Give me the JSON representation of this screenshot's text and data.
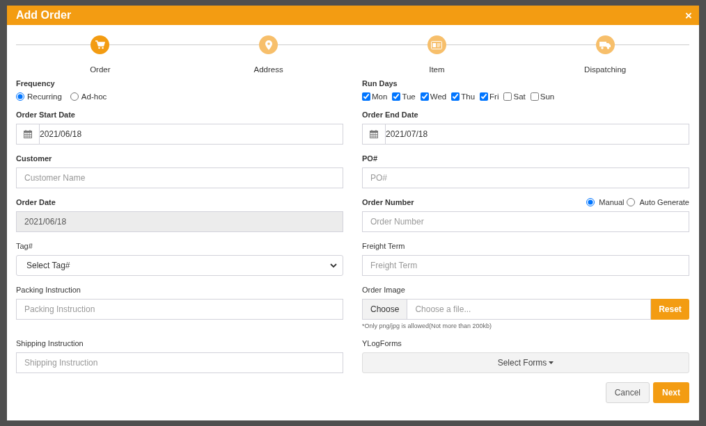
{
  "header": {
    "title": "Add Order",
    "close": "×"
  },
  "steps": [
    {
      "label": "Order",
      "selected": true
    },
    {
      "label": "Address",
      "selected": false
    },
    {
      "label": "Item",
      "selected": false
    },
    {
      "label": "Dispatching",
      "selected": false
    }
  ],
  "rows": [
    {
      "cells": [
        {
          "kind": "radio-group",
          "label": "Frequency",
          "required": true,
          "options": [
            {
              "label": "Recurring",
              "selected": true
            },
            {
              "label": "Ad-hoc",
              "selected": false
            }
          ]
        },
        {
          "kind": "checkbox-group",
          "label": "Run Days",
          "required": true,
          "options": [
            {
              "label": "Mon",
              "checked": true
            },
            {
              "label": "Tue",
              "checked": true
            },
            {
              "label": "Wed",
              "checked": true
            },
            {
              "label": "Thu",
              "checked": true
            },
            {
              "label": "Fri",
              "checked": true
            },
            {
              "label": "Sat",
              "checked": false
            },
            {
              "label": "Sun",
              "checked": false
            }
          ]
        }
      ]
    },
    {
      "cells": [
        {
          "kind": "date",
          "label": "Order Start Date",
          "required": true,
          "value": "2021/06/18"
        },
        {
          "kind": "date",
          "label": "Order End Date",
          "required": true,
          "value": "2021/07/18"
        }
      ]
    },
    {
      "cells": [
        {
          "kind": "text",
          "label": "Customer",
          "required": true,
          "placeholder": "Customer Name"
        },
        {
          "kind": "text",
          "label": "PO#",
          "required": true,
          "placeholder": "PO#"
        }
      ]
    },
    {
      "cells": [
        {
          "kind": "text",
          "label": "Order Date",
          "required": true,
          "value": "2021/06/18",
          "disabled": true
        },
        {
          "kind": "text",
          "label": "Order Number",
          "required": true,
          "placeholder": "Order Number",
          "options": [
            {
              "label": "Manual",
              "selected": true
            },
            {
              "label": "Auto Generate",
              "selected": false
            }
          ]
        }
      ]
    },
    {
      "cells": [
        {
          "kind": "select",
          "label": "Tag#",
          "required": false,
          "value": "Select Tag#"
        },
        {
          "kind": "text",
          "label": "Freight Term",
          "required": false,
          "placeholder": "Freight Term"
        }
      ]
    },
    {
      "cells": [
        {
          "kind": "text",
          "label": "Packing Instruction",
          "required": false,
          "placeholder": "Packing Instruction"
        },
        {
          "kind": "file",
          "label": "Order Image",
          "required": false,
          "button": "Choose",
          "placeholder": "Choose a file...",
          "reset": "Reset",
          "note": "*Only png/jpg is allowed(Not more than 200kb)"
        }
      ]
    },
    {
      "cells": [
        {
          "kind": "text",
          "label": "Shipping Instruction",
          "required": false,
          "placeholder": "Shipping Instruction"
        },
        {
          "kind": "dropdown",
          "label": "YLogForms",
          "required": false,
          "value": "Select Forms"
        }
      ]
    }
  ],
  "buttons": [
    {
      "label": "Cancel",
      "kind": "secondary"
    },
    {
      "label": "Next",
      "kind": "primary"
    }
  ]
}
